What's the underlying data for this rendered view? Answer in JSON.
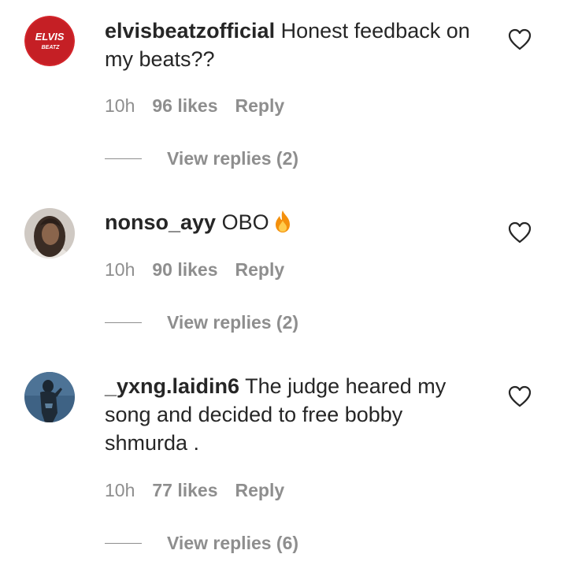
{
  "comments": [
    {
      "username": "elvisbeatzofficial",
      "text": " Honest feedback on my beats??",
      "time": "10h",
      "likes": "96 likes",
      "reply_label": "Reply",
      "view_replies": "View replies (2)",
      "avatar": {
        "type": "logo",
        "logo_line1": "ELVIS",
        "logo_line2": "BEATZ",
        "color": "#d3252b"
      }
    },
    {
      "username": "nonso_ayy",
      "text": " OBO",
      "emoji": "fire-emoji",
      "time": "10h",
      "likes": "90 likes",
      "reply_label": "Reply",
      "view_replies": "View replies (2)",
      "avatar": {
        "type": "photo",
        "color": "#6b5a4e"
      }
    },
    {
      "username": "_yxng.laidin6",
      "text": " The judge heared my song and decided to free bobby shmurda .",
      "time": "10h",
      "likes": "77 likes",
      "reply_label": "Reply",
      "view_replies": "View replies (6)",
      "avatar": {
        "type": "photo",
        "color": "#2f4f6f"
      }
    }
  ],
  "colors": {
    "text": "#262626",
    "secondary": "#8e8e8e",
    "background": "#ffffff"
  },
  "icons": {
    "like": "heart-outline-icon"
  }
}
